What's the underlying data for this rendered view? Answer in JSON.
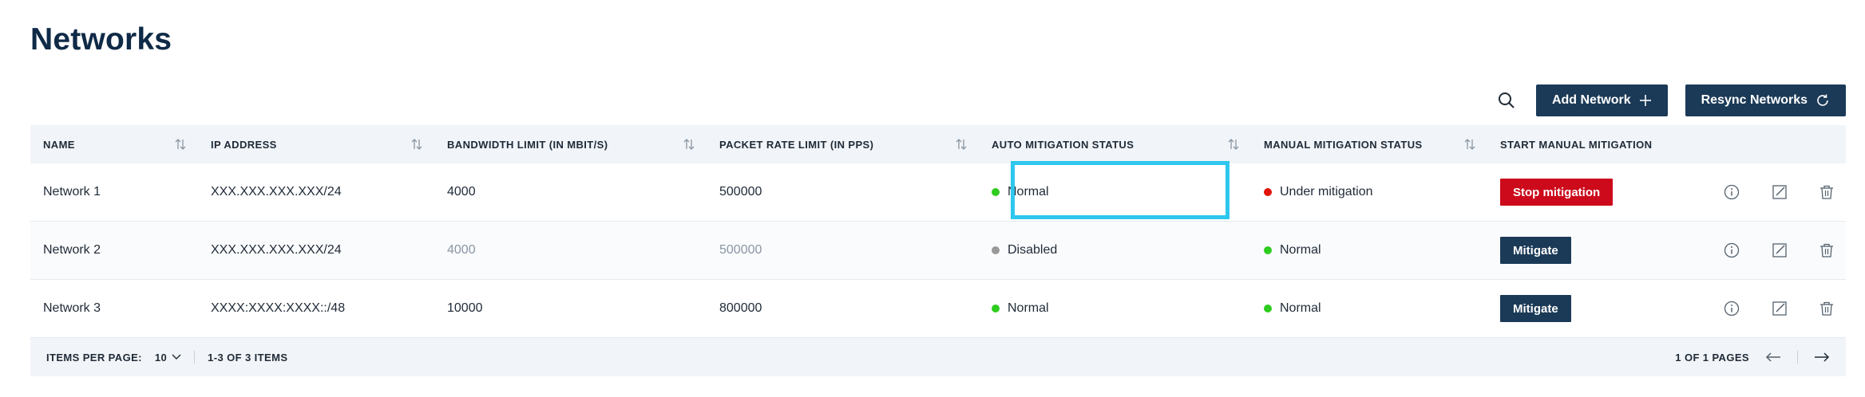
{
  "page": {
    "title": "Networks"
  },
  "toolbar": {
    "search_icon": "search-icon",
    "add_label": "Add Network",
    "resync_label": "Resync Networks"
  },
  "table": {
    "columns": [
      "NAME",
      "IP ADDRESS",
      "BANDWIDTH LIMIT (IN MBIT/S)",
      "PACKET RATE LIMIT (IN PPS)",
      "AUTO MITIGATION STATUS",
      "MANUAL MITIGATION STATUS",
      "START MANUAL MITIGATION"
    ],
    "rows": [
      {
        "name": "Network 1",
        "ip": "XXX.XXX.XXX.XXX/24",
        "bandwidth": "4000",
        "packet_rate": "500000",
        "auto_status": "Normal",
        "auto_color": "#2ecc1f",
        "manual_status": "Under mitigation",
        "manual_color": "#e0140a",
        "action_label": "Stop mitigation"
      },
      {
        "name": "Network 2",
        "ip": "XXX.XXX.XXX.XXX/24",
        "bandwidth": "4000",
        "packet_rate": "500000",
        "auto_status": "Disabled",
        "auto_color": "#999999",
        "manual_status": "Normal",
        "manual_color": "#2ecc1f",
        "action_label": "Mitigate"
      },
      {
        "name": "Network 3",
        "ip": "XXXX:XXXX:XXXX::/48",
        "bandwidth": "10000",
        "packet_rate": "800000",
        "auto_status": "Normal",
        "auto_color": "#2ecc1f",
        "manual_status": "Normal",
        "manual_color": "#2ecc1f",
        "action_label": "Mitigate"
      }
    ]
  },
  "footer": {
    "items_per_page_label": "ITEMS PER PAGE:",
    "items_per_page_value": "10",
    "range_text": "1-3 OF 3 ITEMS",
    "pages_text": "1 OF 1 PAGES"
  },
  "colors": {
    "brand_dark": "#1b3a57",
    "danger": "#cc0a1b",
    "highlight": "#2ec7ee"
  }
}
